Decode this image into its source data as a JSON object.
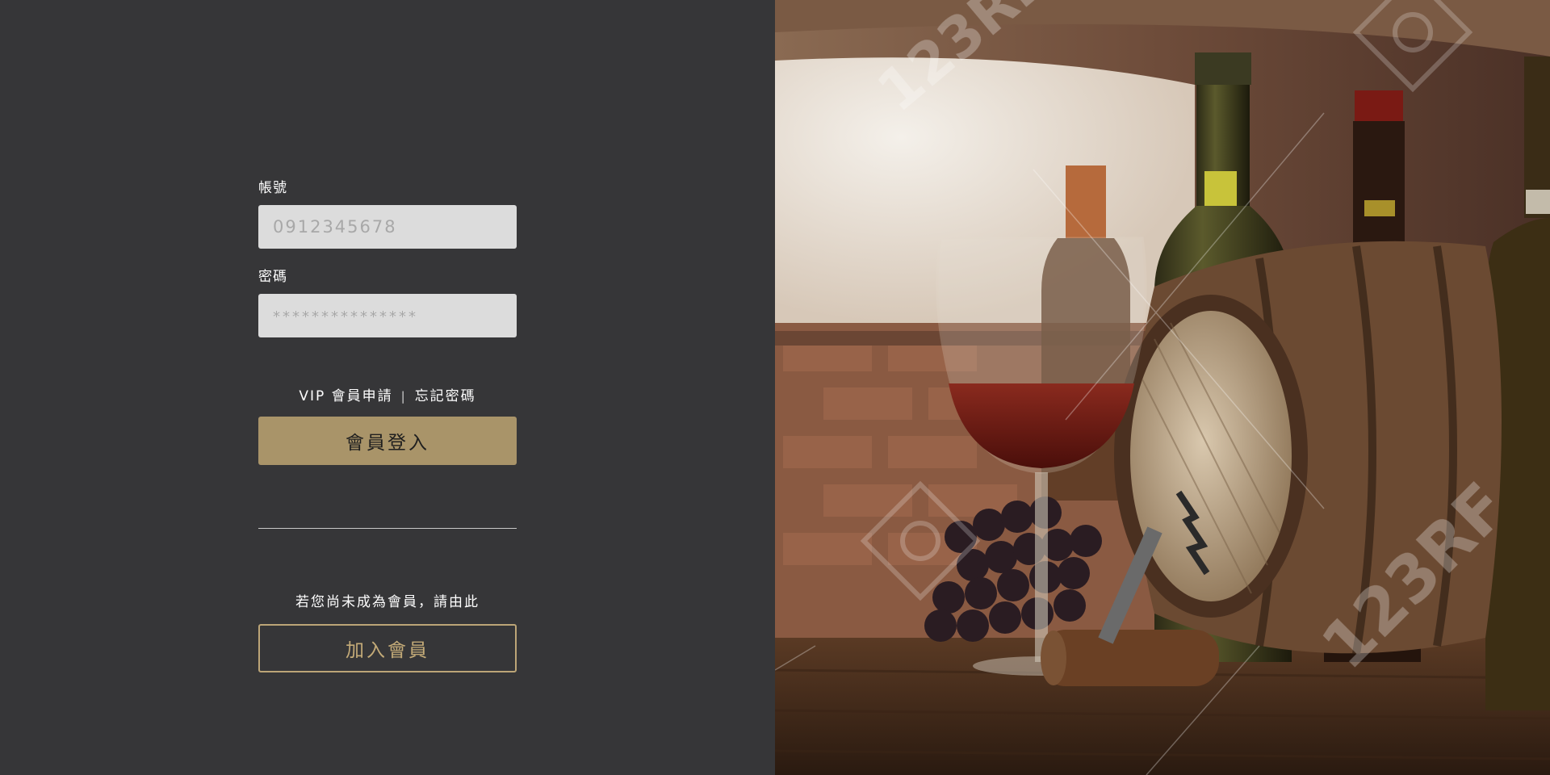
{
  "login_form": {
    "account_label": "帳號",
    "account_placeholder": "0912345678",
    "password_label": "密碼",
    "password_placeholder": "***************",
    "vip_link": "VIP 會員申請",
    "separator": "|",
    "forgot_link": "忘記密碼",
    "login_button": "會員登入"
  },
  "join_section": {
    "prompt": "若您尚未成為會員，請由此",
    "join_button": "加入會員"
  },
  "hero_image": {
    "watermark": "123RF"
  },
  "colors": {
    "background": "#363638",
    "accent_gold": "#a99469",
    "outline_gold": "#bca577",
    "input_bg": "#dcdcdc"
  }
}
